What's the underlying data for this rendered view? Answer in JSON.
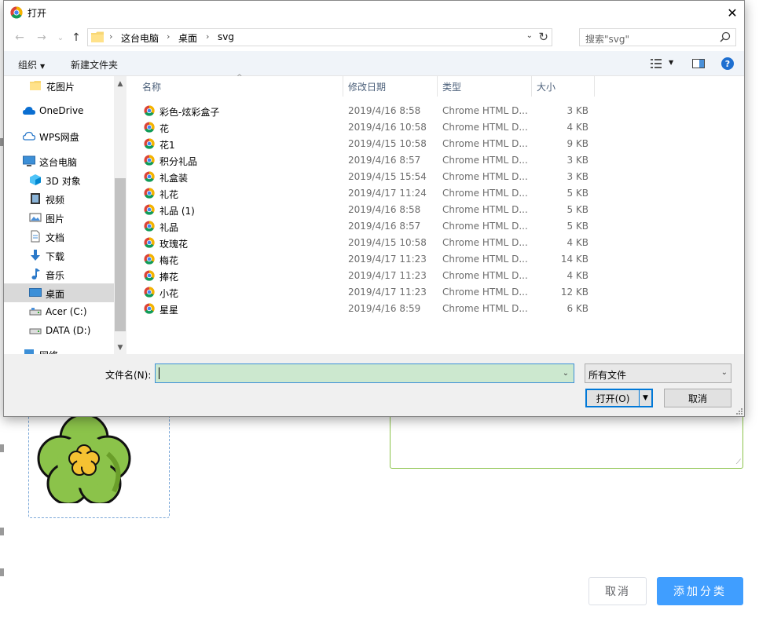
{
  "dialog": {
    "title": "打开",
    "close_glyph": "✕",
    "nav": {
      "back": "←",
      "forward": "→",
      "recent": "⌄",
      "up": "↑"
    },
    "breadcrumb": [
      "这台电脑",
      "桌面",
      "svg"
    ],
    "breadcrumb_sep": "›",
    "address_dropdown": "⌄",
    "refresh_glyph": "↻",
    "search_placeholder": "搜索\"svg\"",
    "toolbar": {
      "organize": "组织",
      "new_folder": "新建文件夹",
      "help": "?"
    },
    "sidebar": {
      "items": [
        {
          "label": "花图片",
          "icon": "folder-icon"
        },
        {
          "label": "OneDrive",
          "icon": "cloud-icon"
        },
        {
          "label": "WPS网盘",
          "icon": "cloud-outline-icon"
        },
        {
          "label": "这台电脑",
          "icon": "computer-icon"
        },
        {
          "label": "3D 对象",
          "icon": "cube-icon"
        },
        {
          "label": "视频",
          "icon": "video-icon"
        },
        {
          "label": "图片",
          "icon": "picture-icon"
        },
        {
          "label": "文档",
          "icon": "document-icon"
        },
        {
          "label": "下载",
          "icon": "download-icon"
        },
        {
          "label": "音乐",
          "icon": "music-icon"
        },
        {
          "label": "桌面",
          "icon": "desktop-icon",
          "selected": true
        },
        {
          "label": "Acer (C:)",
          "icon": "drive-icon"
        },
        {
          "label": "DATA (D:)",
          "icon": "drive-icon"
        },
        {
          "label": "网络",
          "icon": "network-icon"
        }
      ],
      "scroll_up": "▲",
      "scroll_down": "▼"
    },
    "columns": {
      "name": "名称",
      "date": "修改日期",
      "type": "类型",
      "size": "大小"
    },
    "sort_indicator": "^",
    "files": [
      {
        "name": "彩色-炫彩盒子",
        "date": "2019/4/16 8:58",
        "type": "Chrome HTML D...",
        "size": "3 KB"
      },
      {
        "name": "花",
        "date": "2019/4/16 10:58",
        "type": "Chrome HTML D...",
        "size": "4 KB"
      },
      {
        "name": "花1",
        "date": "2019/4/15 10:58",
        "type": "Chrome HTML D...",
        "size": "9 KB"
      },
      {
        "name": "积分礼品",
        "date": "2019/4/16 8:57",
        "type": "Chrome HTML D...",
        "size": "3 KB"
      },
      {
        "name": "礼盒装",
        "date": "2019/4/15 15:54",
        "type": "Chrome HTML D...",
        "size": "3 KB"
      },
      {
        "name": "礼花",
        "date": "2019/4/17 11:24",
        "type": "Chrome HTML D...",
        "size": "5 KB"
      },
      {
        "name": "礼品 (1)",
        "date": "2019/4/16 8:58",
        "type": "Chrome HTML D...",
        "size": "5 KB"
      },
      {
        "name": "礼品",
        "date": "2019/4/16 8:57",
        "type": "Chrome HTML D...",
        "size": "5 KB"
      },
      {
        "name": "玫瑰花",
        "date": "2019/4/15 10:58",
        "type": "Chrome HTML D...",
        "size": "4 KB"
      },
      {
        "name": "梅花",
        "date": "2019/4/17 11:23",
        "type": "Chrome HTML D...",
        "size": "14 KB"
      },
      {
        "name": "捧花",
        "date": "2019/4/17 11:23",
        "type": "Chrome HTML D...",
        "size": "4 KB"
      },
      {
        "name": "小花",
        "date": "2019/4/17 11:23",
        "type": "Chrome HTML D...",
        "size": "12 KB"
      },
      {
        "name": "星星",
        "date": "2019/4/16 8:59",
        "type": "Chrome HTML D...",
        "size": "6 KB"
      }
    ],
    "filename_label": "文件名(N):",
    "filename_value": "",
    "filter_value": "所有文件",
    "open_button": "打开(O)",
    "cancel_button": "取消",
    "dropdown_glyph": "⌄",
    "split_glyph": "▼"
  },
  "page": {
    "cancel_button": "取消",
    "submit_button": "添加分类",
    "accent_color": "#409eff",
    "textarea_resize_glyph": "⟋"
  }
}
